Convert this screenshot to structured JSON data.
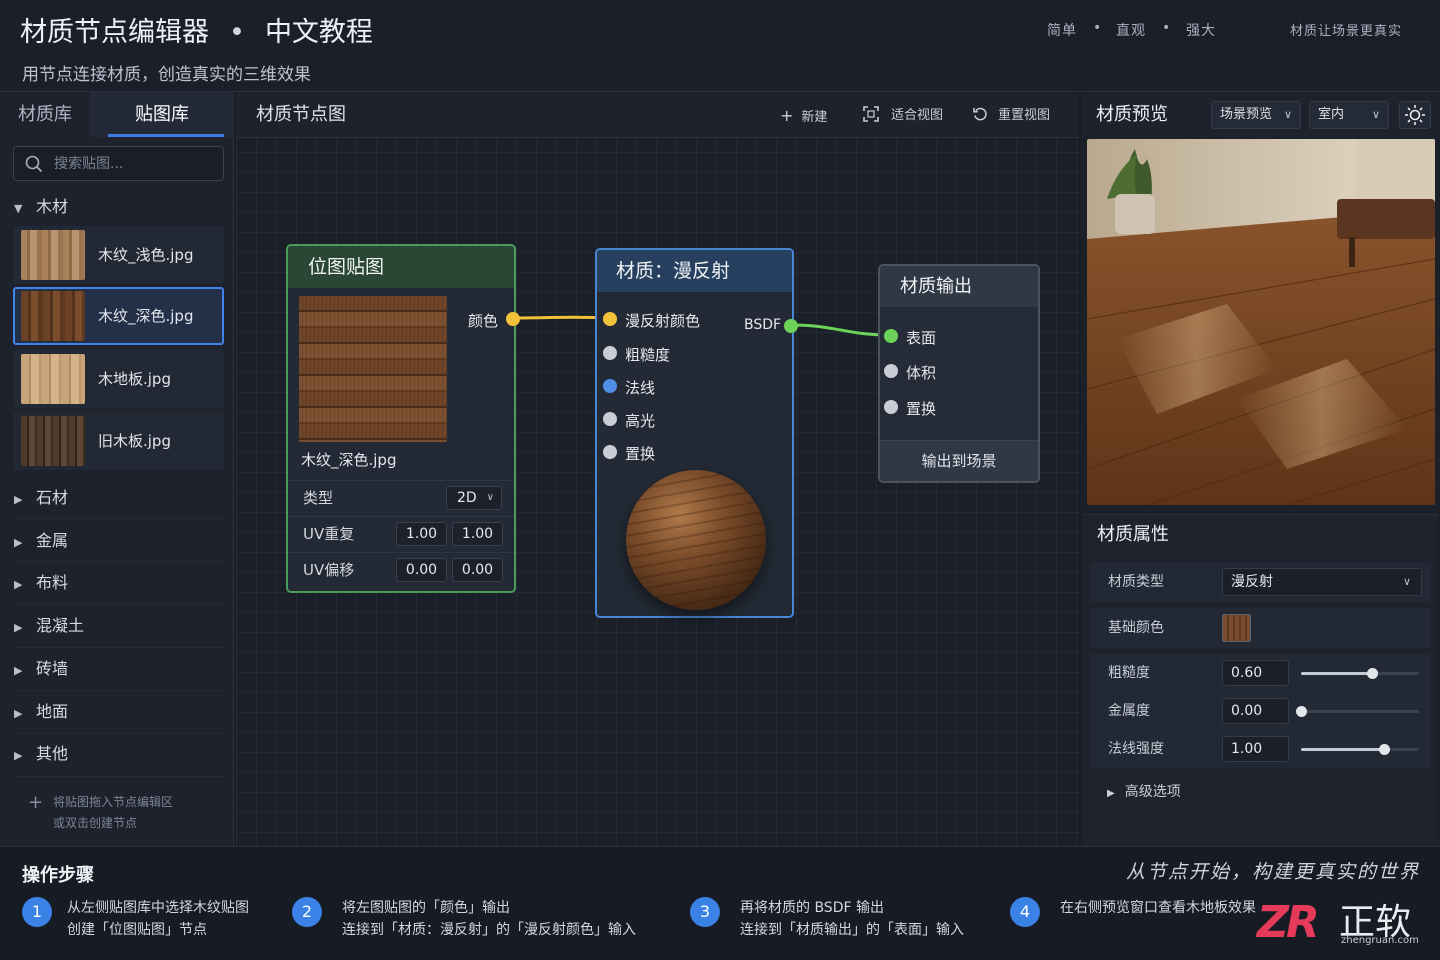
{
  "header": {
    "title": "材质节点编辑器",
    "title_sep": "•",
    "title_sub": "中文教程",
    "subtitle": "用节点连接材质，创造真实的三维效果",
    "tags": [
      "简单",
      "直观",
      "强大"
    ],
    "tag_sep": "•",
    "right_tag": "材质让场景更真实"
  },
  "left_panel": {
    "tabs": [
      {
        "label": "材质库"
      },
      {
        "label": "贴图库"
      }
    ],
    "search_placeholder": "搜索贴图...",
    "open_category": "木材",
    "textures": [
      {
        "name": "木纹_浅色.jpg"
      },
      {
        "name": "木纹_深色.jpg"
      },
      {
        "name": "木地板.jpg"
      },
      {
        "name": "旧木板.jpg"
      }
    ],
    "categories": [
      "石材",
      "金属",
      "布料",
      "混凝土",
      "砖墙",
      "地面",
      "其他"
    ],
    "hint_line1": "将贴图拖入节点编辑区",
    "hint_line2": "或双击创建节点"
  },
  "canvas": {
    "title": "材质节点图",
    "toolbar": {
      "new": "新建",
      "fit": "适合视图",
      "reset": "重置视图"
    },
    "bitmap_node": {
      "title": "位图贴图",
      "output": "颜色",
      "file": "木纹_深色.jpg",
      "type_label": "类型",
      "type_value": "2D",
      "uv_repeat_label": "UV重复",
      "uv_repeat": [
        "1.00",
        "1.00"
      ],
      "uv_offset_label": "UV偏移",
      "uv_offset": [
        "0.00",
        "0.00"
      ]
    },
    "material_node": {
      "title": "材质：漫反射",
      "inputs": [
        "漫反射颜色",
        "粗糙度",
        "法线",
        "高光",
        "置换"
      ],
      "output": "BSDF"
    },
    "output_node": {
      "title": "材质输出",
      "inputs": [
        "表面",
        "体积",
        "置换"
      ],
      "button": "输出到场景"
    }
  },
  "right_panel": {
    "title": "材质预览",
    "scene_dropdown": "场景预览",
    "env_dropdown": "室内",
    "props": {
      "title": "材质属性",
      "type_label": "材质类型",
      "type_value": "漫反射",
      "base_color_label": "基础颜色",
      "roughness_label": "粗糙度",
      "roughness": "0.60",
      "metallic_label": "金属度",
      "metallic": "0.00",
      "normal_label": "法线强度",
      "normal": "1.00",
      "advanced": "高级选项"
    }
  },
  "sliders": {
    "roughness": 0.6,
    "metallic": 0.0,
    "normal_strength": 0.7
  },
  "steps": {
    "title": "操作步骤",
    "slogan": "从节点开始，构建更真实的世界",
    "items": [
      {
        "num": "1",
        "line1": "从左侧贴图库中选择木纹贴图",
        "line2": "创建「位图贴图」节点"
      },
      {
        "num": "2",
        "line1": "将左图贴图的「颜色」输出",
        "line2": "连接到「材质：漫反射」的「漫反射颜色」输入"
      },
      {
        "num": "3",
        "line1": "再将材质的 BSDF 输出",
        "line2": "连接到「材质输出」的「表面」输入"
      },
      {
        "num": "4",
        "line1": "在右侧预览窗口查看木地板效果",
        "line2": ""
      }
    ]
  },
  "logo": {
    "mark": "ZR",
    "text": "正软",
    "url": "zhengruan.com"
  },
  "colors": {
    "accent": "#3d7ee6",
    "bitmap_node": "#4a9c5b",
    "material_node": "#4a86d6",
    "socket_color": "#f3c23a",
    "socket_shader": "#6cd25a"
  }
}
